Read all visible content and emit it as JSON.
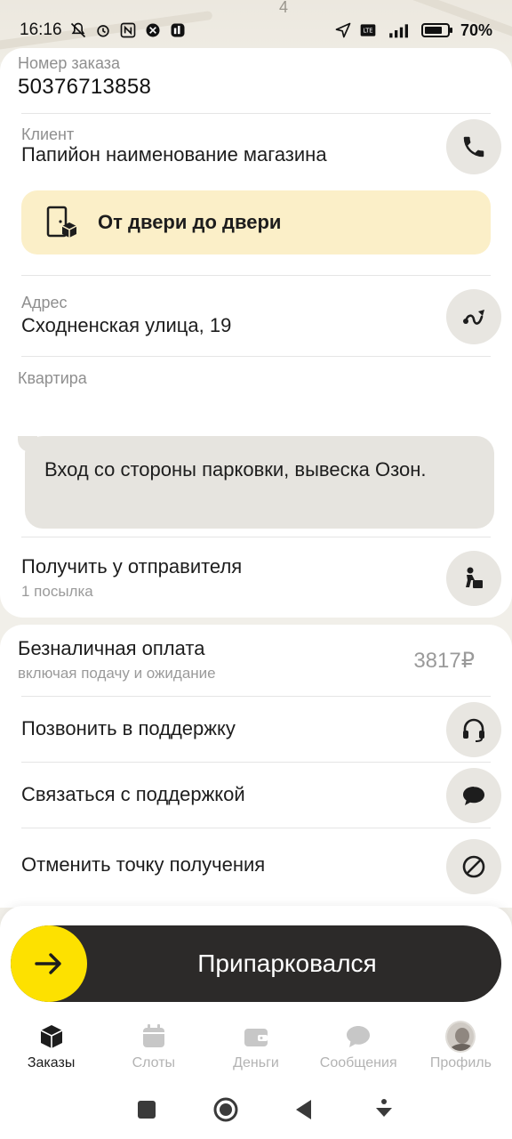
{
  "status_bar": {
    "time": "16:16",
    "battery": "70%",
    "icons_left": [
      "mute-icon",
      "alarm-icon",
      "nfc-icon",
      "app-icon",
      "app2-icon"
    ],
    "icons_right": [
      "location-icon",
      "volte-icon",
      "signal-icon",
      "battery-icon"
    ]
  },
  "order": {
    "number_label": "Номер заказа",
    "number_value": "50376713858",
    "client_label": "Клиент",
    "client_value": "Папийон наименование магазина",
    "delivery_type": "От двери до двери",
    "address_label": "Адрес",
    "address_value": "Сходненская улица, 19",
    "apartment_label": "Квартира",
    "comment": "Вход со стороны парковки, вывеска Озон.",
    "pickup_title": "Получить у отправителя",
    "pickup_sub": "1 посылка"
  },
  "payment": {
    "title": "Безналичная оплата",
    "sub": "включая подачу и ожидание",
    "price": "3817₽"
  },
  "actions": {
    "call_support": "Позвонить в поддержку",
    "chat_support": "Связаться с поддержкой",
    "cancel_pickup": "Отменить точку получения"
  },
  "slide_button": {
    "label": "Припарковался"
  },
  "tabs": [
    {
      "label": "Заказы",
      "icon": "cube-icon",
      "active": true
    },
    {
      "label": "Слоты",
      "icon": "calendar-icon",
      "active": false
    },
    {
      "label": "Деньги",
      "icon": "wallet-icon",
      "active": false
    },
    {
      "label": "Сообщения",
      "icon": "chat-icon",
      "active": false
    },
    {
      "label": "Профиль",
      "icon": "avatar",
      "active": false
    }
  ],
  "colors": {
    "accent_yellow": "#fde100",
    "banner_yellow": "#fbefc8",
    "dark_button": "#2c2a29"
  }
}
